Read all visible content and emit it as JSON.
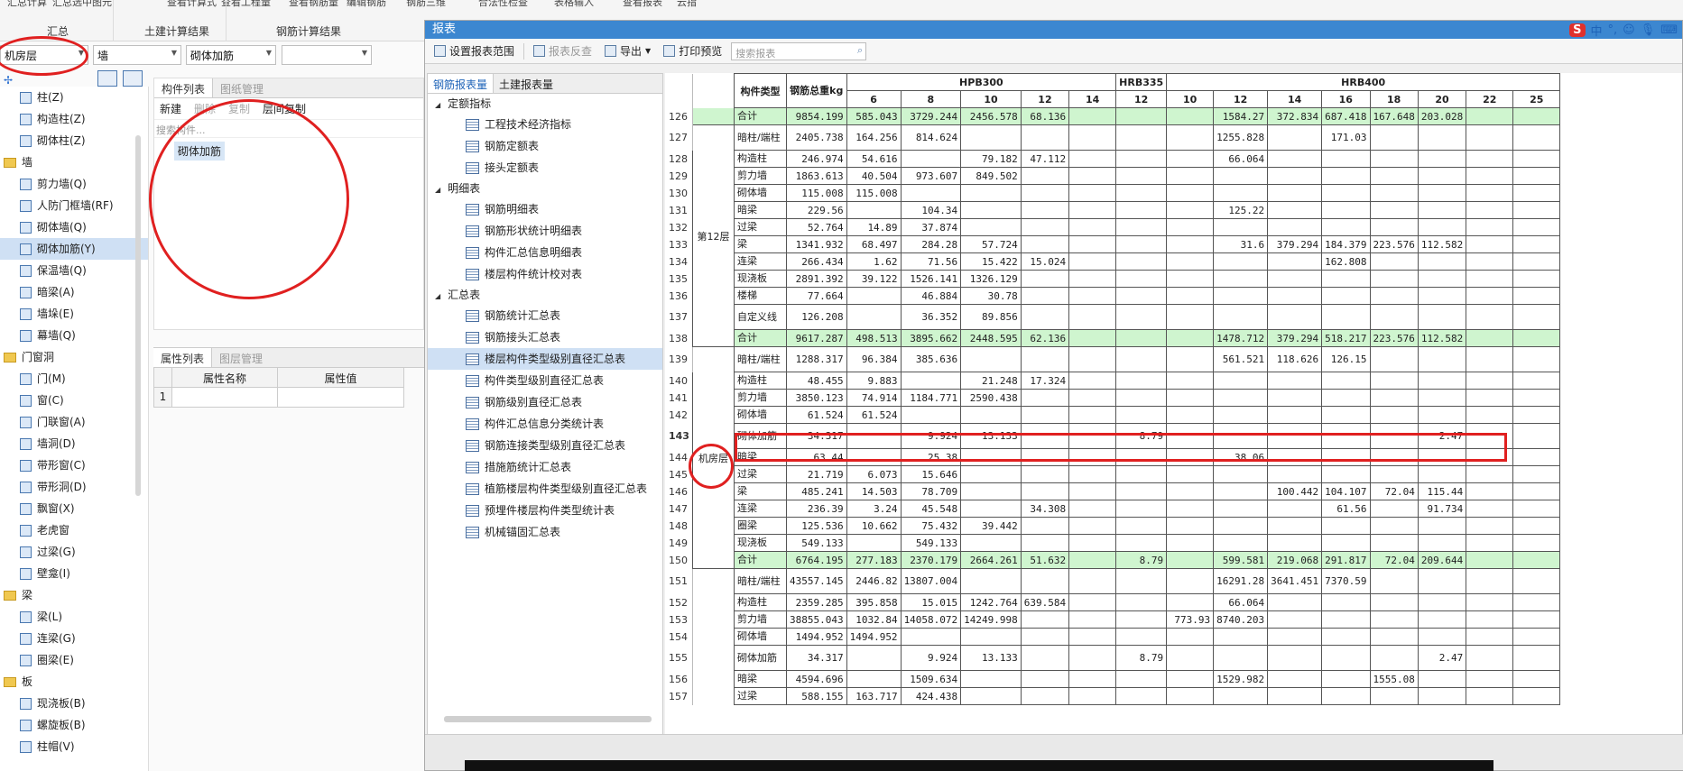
{
  "ribbon": {
    "top_cut": [
      "汇总计算",
      "汇总选中图元",
      "查看计算式",
      "查看工程量",
      "查看钢筋量",
      "编辑钢筋",
      "钢筋三维",
      "合法性检查",
      "表格输入",
      "查看报表",
      "云指标"
    ],
    "groups": [
      "汇总",
      "土建计算结果",
      "钢筋计算结果"
    ]
  },
  "toolbar_combos": {
    "floor": "机房层",
    "category": "墙",
    "type": "砌体加筋",
    "extra": ""
  },
  "nav": [
    {
      "label": "柱(Z)",
      "cat": false
    },
    {
      "label": "构造柱(Z)",
      "cat": false
    },
    {
      "label": "砌体柱(Z)",
      "cat": false
    },
    {
      "label": "墙",
      "cat": true
    },
    {
      "label": "剪力墙(Q)",
      "cat": false
    },
    {
      "label": "人防门框墙(RF)",
      "cat": false
    },
    {
      "label": "砌体墙(Q)",
      "cat": false
    },
    {
      "label": "砌体加筋(Y)",
      "cat": false,
      "sel": true
    },
    {
      "label": "保温墙(Q)",
      "cat": false
    },
    {
      "label": "暗梁(A)",
      "cat": false
    },
    {
      "label": "墙垛(E)",
      "cat": false
    },
    {
      "label": "幕墙(Q)",
      "cat": false
    },
    {
      "label": "门窗洞",
      "cat": true
    },
    {
      "label": "门(M)",
      "cat": false
    },
    {
      "label": "窗(C)",
      "cat": false
    },
    {
      "label": "门联窗(A)",
      "cat": false
    },
    {
      "label": "墙洞(D)",
      "cat": false
    },
    {
      "label": "带形窗(C)",
      "cat": false
    },
    {
      "label": "带形洞(D)",
      "cat": false
    },
    {
      "label": "飘窗(X)",
      "cat": false
    },
    {
      "label": "老虎窗",
      "cat": false
    },
    {
      "label": "过梁(G)",
      "cat": false
    },
    {
      "label": "壁龛(I)",
      "cat": false
    },
    {
      "label": "梁",
      "cat": true
    },
    {
      "label": "梁(L)",
      "cat": false
    },
    {
      "label": "连梁(G)",
      "cat": false
    },
    {
      "label": "圈梁(E)",
      "cat": false
    },
    {
      "label": "板",
      "cat": true
    },
    {
      "label": "现浇板(B)",
      "cat": false
    },
    {
      "label": "螺旋板(B)",
      "cat": false
    },
    {
      "label": "柱帽(V)",
      "cat": false
    }
  ],
  "component_panel": {
    "tabs": [
      "构件列表",
      "图纸管理"
    ],
    "tools": [
      "新建",
      "删除",
      "复制",
      "层间复制"
    ],
    "search_placeholder": "搜索构件...",
    "item": "砌体加筋"
  },
  "property_panel": {
    "tabs": [
      "属性列表",
      "图层管理"
    ],
    "col_name": "属性名称",
    "col_value": "属性值",
    "row1": "1"
  },
  "report_window": {
    "title": "报表",
    "tools": [
      "设置报表范围",
      "报表反查",
      "导出",
      "打印预览"
    ],
    "search_placeholder": "搜索报表",
    "ime": [
      "中",
      "°,",
      "☺"
    ],
    "tabs": [
      "钢筋报表量",
      "土建报表量"
    ],
    "tree": [
      {
        "group": "定额指标",
        "items": [
          "工程技术经济指标",
          "钢筋定额表",
          "接头定额表"
        ]
      },
      {
        "group": "明细表",
        "items": [
          "钢筋明细表",
          "钢筋形状统计明细表",
          "构件汇总信息明细表",
          "楼层构件统计校对表"
        ]
      },
      {
        "group": "汇总表",
        "items": [
          "钢筋统计汇总表",
          "钢筋接头汇总表",
          "楼层构件类型级别直径汇总表",
          "构件类型级别直径汇总表",
          "钢筋级别直径汇总表",
          "构件汇总信息分类统计表",
          "钢筋连接类型级别直径汇总表",
          "措施筋统计汇总表",
          "植筋楼层构件类型级别直径汇总表",
          "预埋件楼层构件类型统计表",
          "机械锚固汇总表"
        ]
      }
    ],
    "selected_item": "楼层构件类型级别直径汇总表"
  },
  "report_table": {
    "header": {
      "type": "构件类型",
      "total": "钢筋总重kg",
      "grades": [
        "HPB300",
        "HRB335",
        "HRB400"
      ],
      "diameters": [
        "6",
        "8",
        "10",
        "12",
        "14",
        "12",
        "10",
        "12",
        "14",
        "16",
        "18",
        "20",
        "22",
        "25"
      ]
    },
    "rows": [
      {
        "n": "126",
        "floor": "",
        "type": "合计",
        "sum": true,
        "v": [
          "9854.199",
          "585.043",
          "3729.244",
          "2456.578",
          "68.136",
          "",
          "",
          "",
          "1584.27",
          "372.834",
          "687.418",
          "167.648",
          "203.028",
          "",
          ""
        ]
      },
      {
        "n": "127",
        "floor": "第12层",
        "type": "暗柱/端柱",
        "v": [
          "2405.738",
          "164.256",
          "814.624",
          "",
          "",
          "",
          "",
          "",
          "1255.828",
          "",
          "171.03",
          "",
          "",
          "",
          ""
        ]
      },
      {
        "n": "128",
        "floor": "",
        "type": "构造柱",
        "v": [
          "246.974",
          "54.616",
          "",
          "79.182",
          "47.112",
          "",
          "",
          "",
          "66.064",
          "",
          "",
          "",
          "",
          "",
          ""
        ]
      },
      {
        "n": "129",
        "floor": "",
        "type": "剪力墙",
        "v": [
          "1863.613",
          "40.504",
          "973.607",
          "849.502",
          "",
          "",
          "",
          "",
          "",
          "",
          "",
          "",
          "",
          "",
          ""
        ]
      },
      {
        "n": "130",
        "floor": "",
        "type": "砌体墙",
        "v": [
          "115.008",
          "115.008",
          "",
          "",
          "",
          "",
          "",
          "",
          "",
          "",
          "",
          "",
          "",
          "",
          ""
        ]
      },
      {
        "n": "131",
        "floor": "",
        "type": "暗梁",
        "v": [
          "229.56",
          "",
          "104.34",
          "",
          "",
          "",
          "",
          "",
          "125.22",
          "",
          "",
          "",
          "",
          "",
          ""
        ]
      },
      {
        "n": "132",
        "floor": "",
        "type": "过梁",
        "v": [
          "52.764",
          "14.89",
          "37.874",
          "",
          "",
          "",
          "",
          "",
          "",
          "",
          "",
          "",
          "",
          "",
          ""
        ]
      },
      {
        "n": "133",
        "floor": "",
        "type": "梁",
        "v": [
          "1341.932",
          "68.497",
          "284.28",
          "57.724",
          "",
          "",
          "",
          "",
          "31.6",
          "379.294",
          "184.379",
          "223.576",
          "112.582",
          "",
          ""
        ]
      },
      {
        "n": "134",
        "floor": "",
        "type": "连梁",
        "v": [
          "266.434",
          "1.62",
          "71.56",
          "15.422",
          "15.024",
          "",
          "",
          "",
          "",
          "",
          "162.808",
          "",
          "",
          "",
          ""
        ]
      },
      {
        "n": "135",
        "floor": "",
        "type": "现浇板",
        "v": [
          "2891.392",
          "39.122",
          "1526.141",
          "1326.129",
          "",
          "",
          "",
          "",
          "",
          "",
          "",
          "",
          "",
          "",
          ""
        ]
      },
      {
        "n": "136",
        "floor": "",
        "type": "楼梯",
        "v": [
          "77.664",
          "",
          "46.884",
          "30.78",
          "",
          "",
          "",
          "",
          "",
          "",
          "",
          "",
          "",
          "",
          ""
        ]
      },
      {
        "n": "137",
        "floor": "",
        "type": "自定义线",
        "v": [
          "126.208",
          "",
          "36.352",
          "89.856",
          "",
          "",
          "",
          "",
          "",
          "",
          "",
          "",
          "",
          "",
          ""
        ]
      },
      {
        "n": "138",
        "floor": "",
        "type": "合计",
        "sum": true,
        "v": [
          "9617.287",
          "498.513",
          "3895.662",
          "2448.595",
          "62.136",
          "",
          "",
          "",
          "1478.712",
          "379.294",
          "518.217",
          "223.576",
          "112.582",
          "",
          ""
        ]
      },
      {
        "n": "139",
        "floor": "机房层",
        "type": "暗柱/端柱",
        "v": [
          "1288.317",
          "96.384",
          "385.636",
          "",
          "",
          "",
          "",
          "",
          "561.521",
          "118.626",
          "126.15",
          "",
          "",
          "",
          ""
        ]
      },
      {
        "n": "140",
        "floor": "",
        "type": "构造柱",
        "v": [
          "48.455",
          "9.883",
          "",
          "21.248",
          "17.324",
          "",
          "",
          "",
          "",
          "",
          "",
          "",
          "",
          "",
          ""
        ]
      },
      {
        "n": "141",
        "floor": "",
        "type": "剪力墙",
        "v": [
          "3850.123",
          "74.914",
          "1184.771",
          "2590.438",
          "",
          "",
          "",
          "",
          "",
          "",
          "",
          "",
          "",
          "",
          ""
        ]
      },
      {
        "n": "142",
        "floor": "",
        "type": "砌体墙",
        "v": [
          "61.524",
          "61.524",
          "",
          "",
          "",
          "",
          "",
          "",
          "",
          "",
          "",
          "",
          "",
          "",
          ""
        ]
      },
      {
        "n": "143",
        "floor": "",
        "type": "砌体加筋",
        "hl": true,
        "v": [
          "34.317",
          "",
          "9.924",
          "13.133",
          "",
          "",
          "8.79",
          "",
          "",
          "",
          "",
          "",
          "2.47",
          "",
          ""
        ]
      },
      {
        "n": "144",
        "floor": "",
        "type": "暗梁",
        "v": [
          "63.44",
          "",
          "25.38",
          "",
          "",
          "",
          "",
          "",
          "38.06",
          "",
          "",
          "",
          "",
          "",
          ""
        ]
      },
      {
        "n": "145",
        "floor": "",
        "type": "过梁",
        "v": [
          "21.719",
          "6.073",
          "15.646",
          "",
          "",
          "",
          "",
          "",
          "",
          "",
          "",
          "",
          "",
          "",
          ""
        ]
      },
      {
        "n": "146",
        "floor": "",
        "type": "梁",
        "v": [
          "485.241",
          "14.503",
          "78.709",
          "",
          "",
          "",
          "",
          "",
          "",
          "100.442",
          "104.107",
          "72.04",
          "115.44",
          "",
          ""
        ]
      },
      {
        "n": "147",
        "floor": "",
        "type": "连梁",
        "v": [
          "236.39",
          "3.24",
          "45.548",
          "",
          "34.308",
          "",
          "",
          "",
          "",
          "",
          "61.56",
          "",
          "91.734",
          "",
          ""
        ]
      },
      {
        "n": "148",
        "floor": "",
        "type": "圈梁",
        "v": [
          "125.536",
          "10.662",
          "75.432",
          "39.442",
          "",
          "",
          "",
          "",
          "",
          "",
          "",
          "",
          "",
          "",
          ""
        ]
      },
      {
        "n": "149",
        "floor": "",
        "type": "现浇板",
        "v": [
          "549.133",
          "",
          "549.133",
          "",
          "",
          "",
          "",
          "",
          "",
          "",
          "",
          "",
          "",
          "",
          ""
        ]
      },
      {
        "n": "150",
        "floor": "",
        "type": "合计",
        "sum": true,
        "v": [
          "6764.195",
          "277.183",
          "2370.179",
          "2664.261",
          "51.632",
          "",
          "8.79",
          "",
          "599.581",
          "219.068",
          "291.817",
          "72.04",
          "209.644",
          "",
          ""
        ]
      },
      {
        "n": "151",
        "floor": "",
        "type": "暗柱/端柱",
        "v": [
          "43557.145",
          "2446.82",
          "13807.004",
          "",
          "",
          "",
          "",
          "",
          "16291.28",
          "3641.451",
          "7370.59",
          "",
          "",
          "",
          ""
        ]
      },
      {
        "n": "152",
        "floor": "",
        "type": "构造柱",
        "v": [
          "2359.285",
          "395.858",
          "15.015",
          "1242.764",
          "639.584",
          "",
          "",
          "",
          "66.064",
          "",
          "",
          "",
          "",
          "",
          ""
        ]
      },
      {
        "n": "153",
        "floor": "",
        "type": "剪力墙",
        "v": [
          "38855.043",
          "1032.84",
          "14058.072",
          "14249.998",
          "",
          "",
          "",
          "773.93",
          "8740.203",
          "",
          "",
          "",
          "",
          "",
          ""
        ]
      },
      {
        "n": "154",
        "floor": "",
        "type": "砌体墙",
        "v": [
          "1494.952",
          "1494.952",
          "",
          "",
          "",
          "",
          "",
          "",
          "",
          "",
          "",
          "",
          "",
          "",
          ""
        ]
      },
      {
        "n": "155",
        "floor": "",
        "type": "砌体加筋",
        "v": [
          "34.317",
          "",
          "9.924",
          "13.133",
          "",
          "",
          "8.79",
          "",
          "",
          "",
          "",
          "",
          "2.47",
          "",
          ""
        ]
      },
      {
        "n": "156",
        "floor": "",
        "type": "暗梁",
        "v": [
          "4594.696",
          "",
          "1509.634",
          "",
          "",
          "",
          "",
          "",
          "1529.982",
          "",
          "",
          "1555.08",
          "",
          "",
          ""
        ]
      },
      {
        "n": "157",
        "floor": "",
        "type": "过梁",
        "v": [
          "588.155",
          "163.717",
          "424.438",
          "",
          "",
          "",
          "",
          "",
          "",
          "",
          "",
          "",
          "",
          "",
          ""
        ]
      }
    ]
  }
}
